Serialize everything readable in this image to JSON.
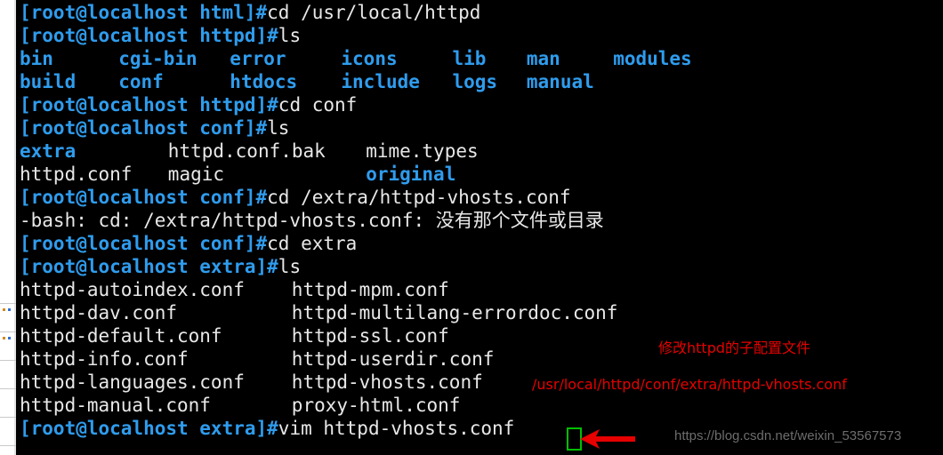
{
  "colors": {
    "background": "#000000",
    "prompt_blue": "#2f9ced",
    "text_white": "#e8e8e8",
    "annotation_red": "#e60000",
    "cursor_green": "#00c000",
    "watermark_gray": "#6d6d6d",
    "gutter_white": "#ffffff"
  },
  "terminal": {
    "prompt_user_host": "[root@localhost",
    "lines": [
      {
        "type": "command",
        "prompt": "[root@localhost html]#",
        "command": "cd /usr/local/httpd"
      },
      {
        "type": "command",
        "prompt": "[root@localhost httpd]#",
        "command": "ls"
      },
      {
        "type": "listing",
        "items": [
          {
            "name": "bin",
            "kind": "dir"
          },
          {
            "name": "cgi-bin",
            "kind": "dir"
          },
          {
            "name": "error",
            "kind": "dir"
          },
          {
            "name": "icons",
            "kind": "dir"
          },
          {
            "name": "lib",
            "kind": "dir"
          },
          {
            "name": "man",
            "kind": "dir"
          },
          {
            "name": "modules",
            "kind": "dir"
          }
        ],
        "columns": [
          0,
          8,
          17,
          26,
          35,
          41,
          48
        ]
      },
      {
        "type": "listing",
        "items": [
          {
            "name": "build",
            "kind": "dir"
          },
          {
            "name": "conf",
            "kind": "dir"
          },
          {
            "name": "htdocs",
            "kind": "dir"
          },
          {
            "name": "include",
            "kind": "dir"
          },
          {
            "name": "logs",
            "kind": "dir"
          },
          {
            "name": "manual",
            "kind": "dir"
          }
        ],
        "columns": [
          0,
          8,
          17,
          26,
          35,
          41
        ]
      },
      {
        "type": "command",
        "prompt": "[root@localhost httpd]#",
        "command": "cd conf"
      },
      {
        "type": "command",
        "prompt": "[root@localhost conf]#",
        "command": "ls"
      },
      {
        "type": "listing",
        "items": [
          {
            "name": "extra",
            "kind": "dir"
          },
          {
            "name": "httpd.conf.bak",
            "kind": "file"
          },
          {
            "name": "mime.types",
            "kind": "file"
          }
        ],
        "columns": [
          0,
          12,
          28
        ]
      },
      {
        "type": "listing",
        "items": [
          {
            "name": "httpd.conf",
            "kind": "file"
          },
          {
            "name": "magic",
            "kind": "file"
          },
          {
            "name": "original",
            "kind": "dir"
          }
        ],
        "columns": [
          0,
          12,
          28
        ]
      },
      {
        "type": "command",
        "prompt": "[root@localhost conf]#",
        "command": "cd /extra/httpd-vhosts.conf"
      },
      {
        "type": "error",
        "text": "-bash: cd: /extra/httpd-vhosts.conf: 没有那个文件或目录"
      },
      {
        "type": "command",
        "prompt": "[root@localhost conf]#",
        "command": "cd extra"
      },
      {
        "type": "command",
        "prompt": "[root@localhost extra]#",
        "command": "ls"
      },
      {
        "type": "listing",
        "items": [
          {
            "name": "httpd-autoindex.conf",
            "kind": "file"
          },
          {
            "name": "httpd-mpm.conf",
            "kind": "file"
          }
        ],
        "columns": [
          0,
          22
        ]
      },
      {
        "type": "listing",
        "items": [
          {
            "name": "httpd-dav.conf",
            "kind": "file"
          },
          {
            "name": "httpd-multilang-errordoc.conf",
            "kind": "file"
          }
        ],
        "columns": [
          0,
          22
        ]
      },
      {
        "type": "listing",
        "items": [
          {
            "name": "httpd-default.conf",
            "kind": "file"
          },
          {
            "name": "httpd-ssl.conf",
            "kind": "file"
          }
        ],
        "columns": [
          0,
          22
        ]
      },
      {
        "type": "listing",
        "items": [
          {
            "name": "httpd-info.conf",
            "kind": "file"
          },
          {
            "name": "httpd-userdir.conf",
            "kind": "file"
          }
        ],
        "columns": [
          0,
          22
        ]
      },
      {
        "type": "listing",
        "items": [
          {
            "name": "httpd-languages.conf",
            "kind": "file"
          },
          {
            "name": "httpd-vhosts.conf",
            "kind": "file"
          }
        ],
        "columns": [
          0,
          22
        ]
      },
      {
        "type": "listing",
        "items": [
          {
            "name": "httpd-manual.conf",
            "kind": "file"
          },
          {
            "name": "proxy-html.conf",
            "kind": "file"
          }
        ],
        "columns": [
          0,
          22
        ]
      },
      {
        "type": "command",
        "prompt": "[root@localhost extra]#",
        "command": "vim httpd-vhosts.conf"
      }
    ]
  },
  "annotations": {
    "title": "修改httpd的子配置文件",
    "path": "/usr/local/httpd/conf/extra/httpd-vhosts.conf"
  },
  "watermark": {
    "text": "https://blog.csdn.net/weixin_53567573"
  },
  "gutter": {
    "separator_rows": [
      341,
      373,
      405,
      437,
      469,
      501
    ],
    "dot_rows": [
      347,
      379
    ]
  }
}
